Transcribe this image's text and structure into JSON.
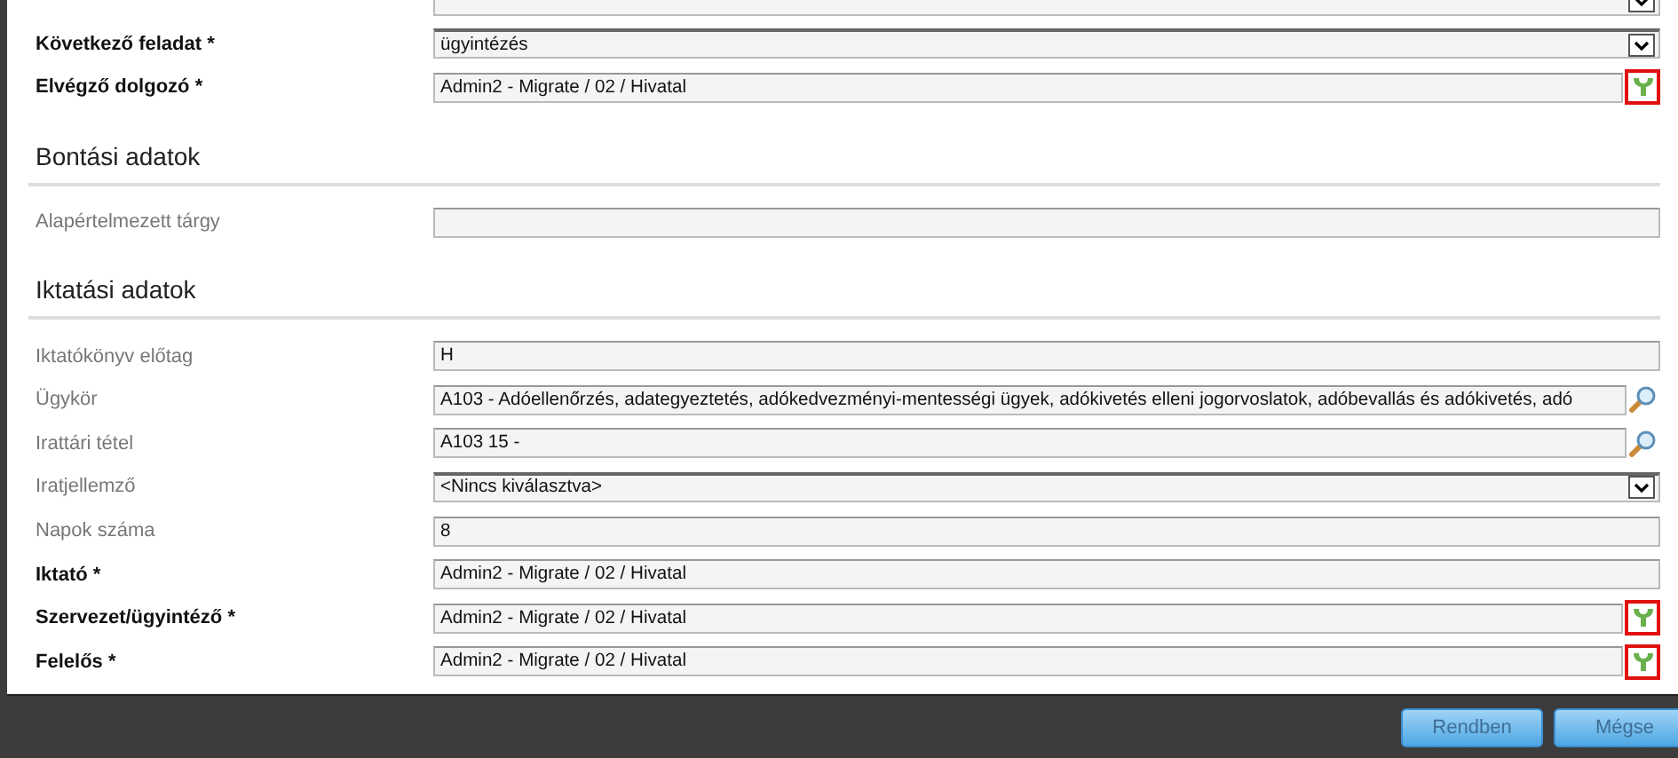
{
  "sections": [
    {
      "rows": [
        {
          "kind": "dropdown"
        },
        {
          "label": "Következő feladat *",
          "required": true,
          "kind": "dropdown",
          "value": "ügyintézés"
        },
        {
          "label": "Elvégző dolgozó *",
          "required": true,
          "kind": "picker",
          "value": "Admin2 - Migrate / 02 / Hivatal"
        }
      ]
    },
    {
      "title": "Bontási adatok",
      "rows": [
        {
          "label": "Alapértelmezett tárgy",
          "required": false,
          "kind": "text"
        }
      ]
    },
    {
      "title": "Iktatási adatok",
      "rows": [
        {
          "label": "Iktatókönyv előtag",
          "required": false,
          "kind": "text",
          "value": "H"
        },
        {
          "label": "Ügykör",
          "required": false,
          "kind": "lookup",
          "value": "A103 - Adóellenőrzés, adategyeztetés, adókedvezményi-mentességi ügyek, adókivetés elleni jogorvoslatok, adóbevallás és adókivetés, adó"
        },
        {
          "label": "Irattári tétel",
          "required": false,
          "kind": "lookup",
          "value": "A103 15 -"
        },
        {
          "label": "Iratjellemző",
          "required": false,
          "kind": "dropdown",
          "value": "<Nincs kiválasztva>"
        },
        {
          "label": "Napok száma",
          "required": false,
          "kind": "text",
          "value": "8"
        },
        {
          "label": "Iktató *",
          "required": true,
          "kind": "text",
          "value": "Admin2 - Migrate / 02 / Hivatal"
        },
        {
          "label": "Szervezet/ügyintéző *",
          "required": true,
          "kind": "picker",
          "value": "Admin2 - Migrate / 02 / Hivatal"
        },
        {
          "label": "Felelős *",
          "required": true,
          "kind": "picker",
          "value": "Admin2 - Migrate / 02 / Hivatal"
        }
      ]
    }
  ],
  "buttons": [
    "Rendben",
    "Mégse"
  ]
}
